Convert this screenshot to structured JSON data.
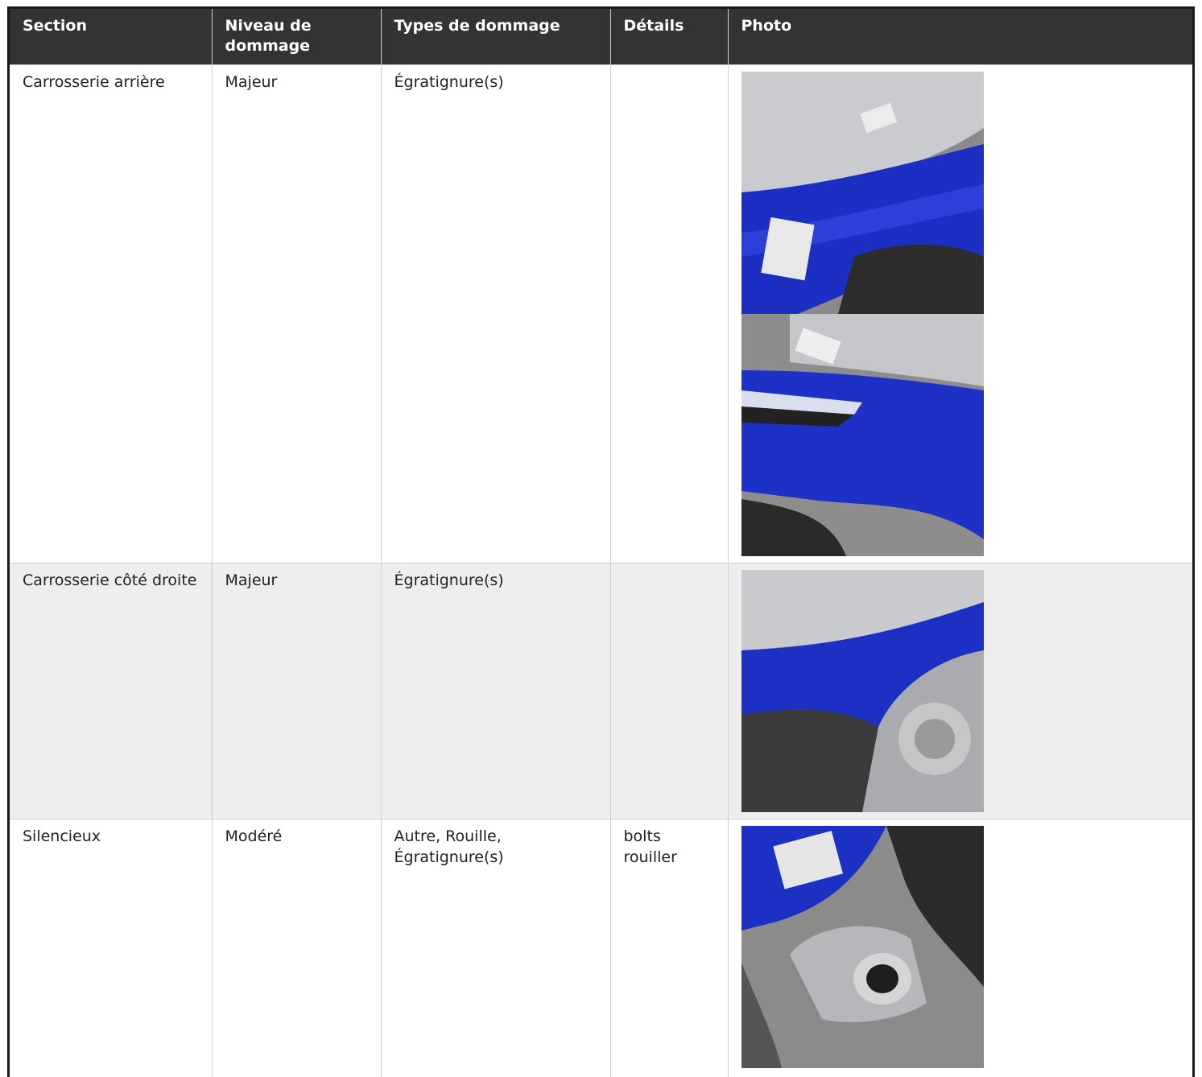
{
  "table": {
    "headers": [
      "Section",
      "Niveau de dommage",
      "Types de dommage",
      "Détails",
      "Photo"
    ],
    "rows": [
      {
        "section": "Carrosserie arrière",
        "niveau": "Majeur",
        "types": "Égratignure(s)",
        "details": "",
        "photos": [
          "blue-atv-rear-fender-photo",
          "blue-atv-rear-side-photo"
        ]
      },
      {
        "section": "Carrosserie côté droite",
        "niveau": "Majeur",
        "types": "Égratignure(s)",
        "details": "",
        "photos": [
          "blue-atv-right-side-photo"
        ]
      },
      {
        "section": "Silencieux",
        "niveau": "Modéré",
        "types": "Autre, Rouille, Égratignure(s)",
        "details": "bolts rouiller",
        "photos": [
          "atv-muffler-photo"
        ]
      }
    ]
  }
}
